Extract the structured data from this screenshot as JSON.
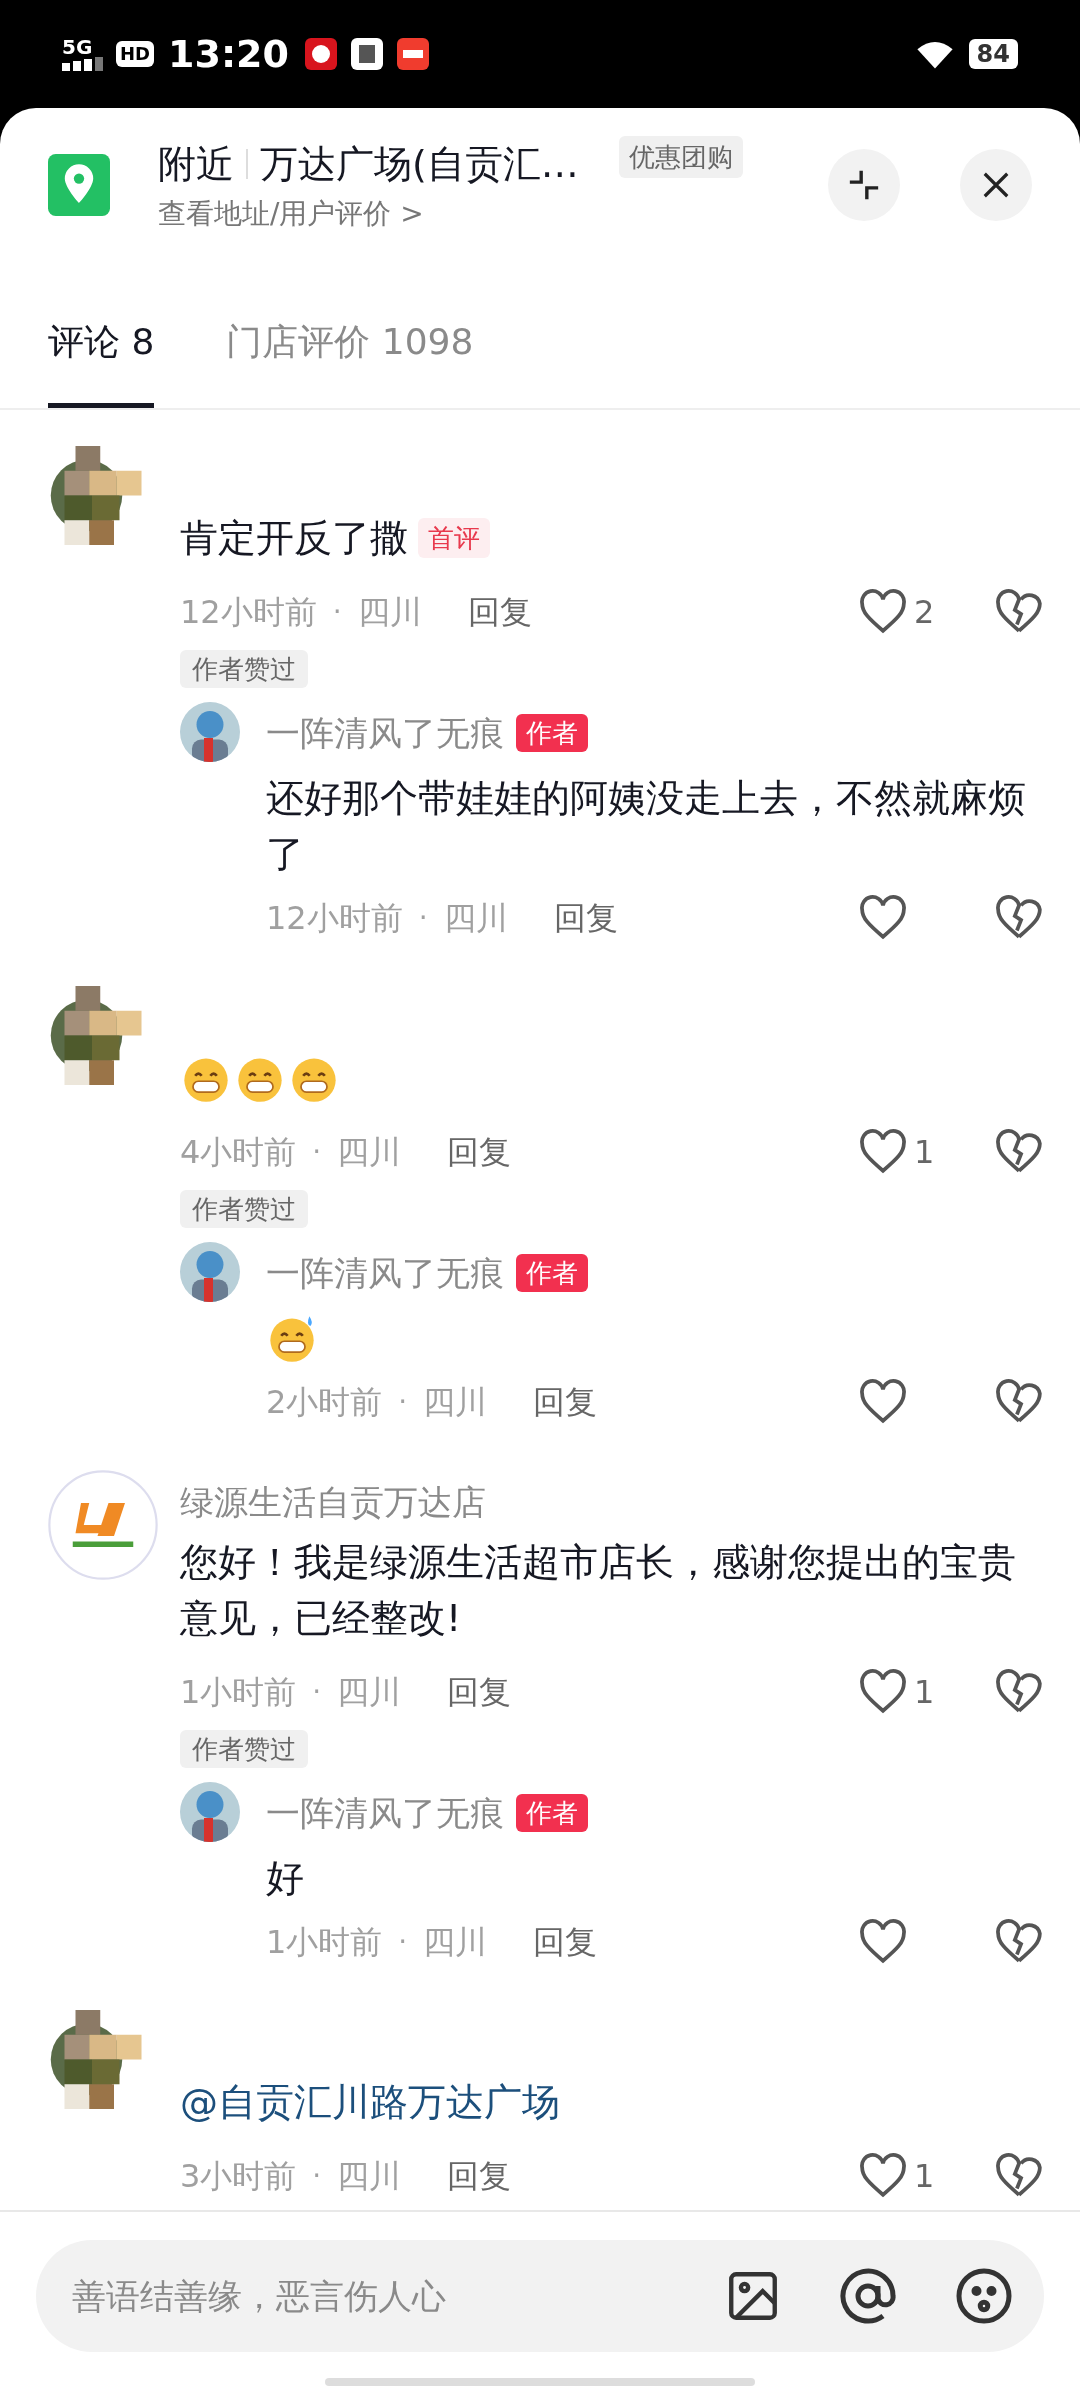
{
  "status_bar": {
    "network": "5G",
    "hd": "HD",
    "time": "13:20",
    "battery": "84"
  },
  "header": {
    "title_prefix": "附近",
    "title": "万达广场(自贡汇…",
    "subtitle": "查看地址/用户评价 >",
    "badge": "优惠团购"
  },
  "tabs": [
    {
      "label": "评论 8",
      "selected": true
    },
    {
      "label": "门店评价 1098",
      "selected": false
    }
  ],
  "comments": [
    {
      "avatar": {
        "kind": "picture"
      },
      "content": {
        "kind": "text",
        "text": "肯定开反了撒"
      },
      "badge": "首评",
      "time": "12小时前",
      "separator": "·",
      "region": "四川",
      "reply": "回复",
      "likes": "2",
      "tag": "作者赞过",
      "replies": [
        {
          "name": "一阵清风了无痕",
          "badge": "作者",
          "content": {
            "kind": "text",
            "text": "还好那个带娃娃的阿姨没走上去，不然就麻烦了"
          },
          "time": "12小时前",
          "separator": "·",
          "region": "四川",
          "reply": "回复"
        }
      ]
    },
    {
      "avatar": {
        "kind": "picture"
      },
      "content": {
        "kind": "emoji",
        "emoji": [
          {
            "kind": "grin"
          },
          {
            "kind": "grin"
          },
          {
            "kind": "grin"
          }
        ]
      },
      "time": "4小时前",
      "separator": "·",
      "region": "四川",
      "reply": "回复",
      "likes": "1",
      "tag": "作者赞过",
      "replies": [
        {
          "name": "一阵清风了无痕",
          "badge": "作者",
          "content": {
            "kind": "emoji",
            "emoji": [
              {
                "kind": "grin_sweat"
              }
            ]
          },
          "time": "2小时前",
          "separator": "·",
          "region": "四川",
          "reply": "回复"
        }
      ]
    },
    {
      "avatar": {
        "kind": "logo"
      },
      "name": "绿源生活自贡万达店",
      "content": {
        "kind": "text",
        "text": "您好！我是绿源生活超市店长，感谢您提出的宝贵意见，已经整改!"
      },
      "time": "1小时前",
      "separator": "·",
      "region": "四川",
      "reply": "回复",
      "likes": "1",
      "tag": "作者赞过",
      "replies": [
        {
          "name": "一阵清风了无痕",
          "badge": "作者",
          "content": {
            "kind": "text",
            "text": "好"
          },
          "time": "1小时前",
          "separator": "·",
          "region": "四川",
          "reply": "回复"
        }
      ]
    },
    {
      "avatar": {
        "kind": "picture"
      },
      "content": {
        "kind": "mention",
        "text": "@自贡汇川路万达广场"
      },
      "time": "3小时前",
      "separator": "·",
      "region": "四川",
      "reply": "回复",
      "likes": "1"
    }
  ],
  "input": {
    "placeholder": "善语结善缘，恶言伤人心"
  }
}
